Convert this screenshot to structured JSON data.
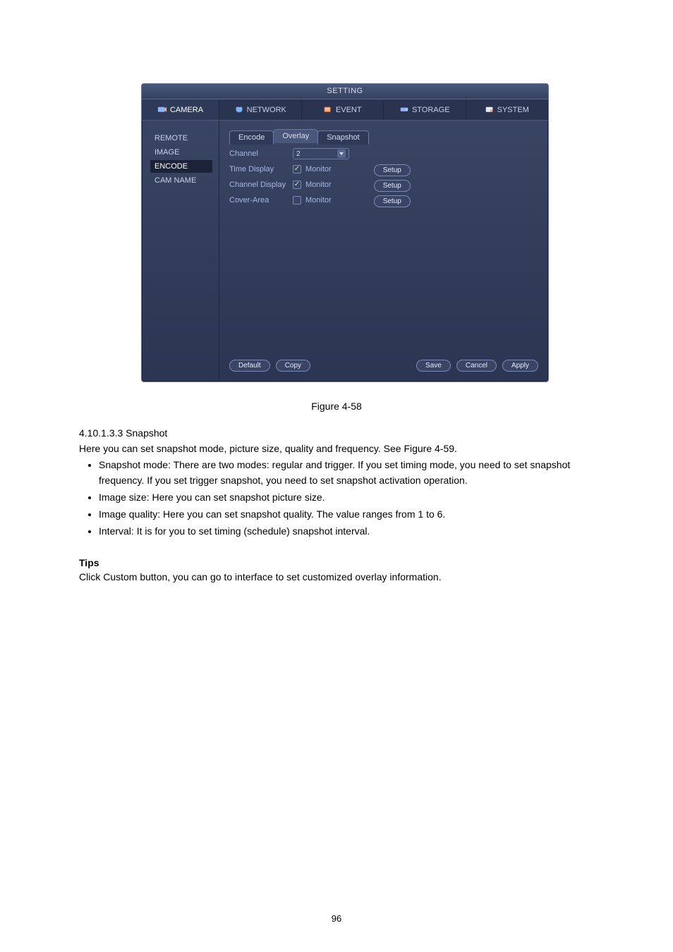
{
  "dialog": {
    "title": "SETTING",
    "topnav": [
      {
        "label": "CAMERA"
      },
      {
        "label": "NETWORK"
      },
      {
        "label": "EVENT"
      },
      {
        "label": "STORAGE"
      },
      {
        "label": "SYSTEM"
      }
    ],
    "sidebar": [
      {
        "label": "REMOTE"
      },
      {
        "label": "IMAGE"
      },
      {
        "label": "ENCODE"
      },
      {
        "label": "CAM NAME"
      }
    ],
    "tabs": {
      "encode": "Encode",
      "overlay": "Overlay",
      "snapshot": "Snapshot"
    },
    "rows": {
      "channel_label": "Channel",
      "channel_value": "2",
      "time_display_label": "Time Display",
      "channel_display_label": "Channel Display",
      "cover_area_label": "Cover-Area",
      "monitor": "Monitor",
      "setup": "Setup"
    },
    "footer": {
      "default": "Default",
      "copy": "Copy",
      "save": "Save",
      "cancel": "Cancel",
      "apply": "Apply"
    }
  },
  "doc": {
    "fig_caption": "Figure 4-58",
    "section_title": "4.10.1.3.3 Snapshot",
    "intro": "Here you can set snapshot mode, picture size, quality and frequency. See Figure 4-59.",
    "bullets": [
      "Snapshot mode: There are two modes: regular and trigger. If you set timing mode, you need to set snapshot frequency. If you set trigger snapshot, you need to set snapshot activation operation.",
      "Image size: Here you can set snapshot picture size.",
      "Image quality: Here you can set snapshot quality. The value ranges from 1 to 6.",
      "Interval: It is for you to set timing (schedule) snapshot interval."
    ],
    "tips_label": "Tips",
    "tips_body": "Click Custom button, you can go to interface to set customized overlay information.",
    "page_number": "96"
  }
}
